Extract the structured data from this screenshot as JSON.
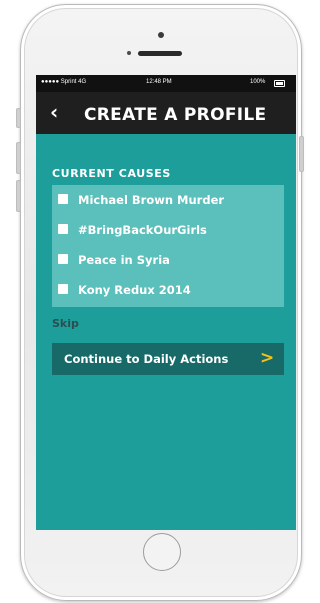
{
  "status_bar": {
    "carrier": "●●●●● Sprint 4G",
    "time": "12:48 PM",
    "battery": "100%"
  },
  "header": {
    "back_icon": "‹",
    "title": "CREATE A PROFILE"
  },
  "section": {
    "title": "CURRENT CAUSES"
  },
  "causes": [
    {
      "label": "Michael Brown Murder",
      "checked": false
    },
    {
      "label": "#BringBackOurGirls",
      "checked": false
    },
    {
      "label": "Peace in Syria",
      "checked": false
    },
    {
      "label": "Kony Redux 2014",
      "checked": false
    }
  ],
  "skip_label": "Skip",
  "cta": {
    "label": "Continue to Daily Actions",
    "arrow": ">"
  },
  "colors": {
    "screen_bg": "#1e9e9a",
    "causes_bg": "#5bbfbb",
    "header_bg": "#1f1f1f",
    "cta_bg": "#176a68",
    "cta_arrow": "#f5c21a"
  },
  "icons": {
    "back": "back-chevron-icon",
    "battery": "battery-icon",
    "cta_arrow": "chevron-right-icon"
  }
}
